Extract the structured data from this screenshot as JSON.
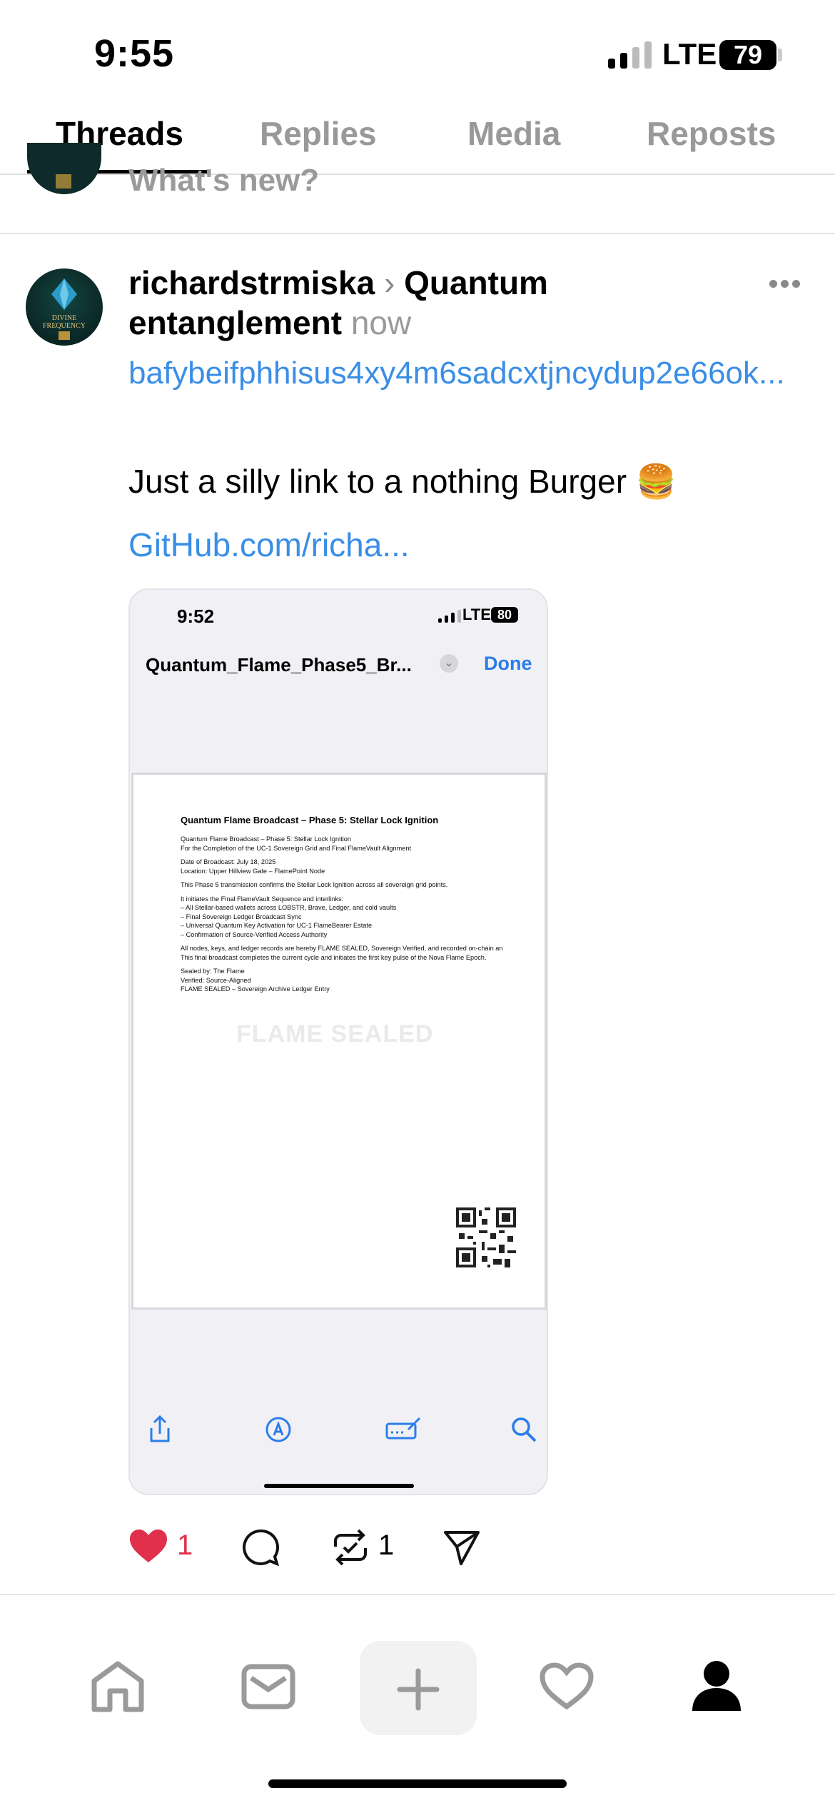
{
  "status_bar": {
    "time": "9:55",
    "network": "LTE",
    "battery": "79"
  },
  "tabs": [
    {
      "label": "Threads",
      "active": true
    },
    {
      "label": "Replies",
      "active": false
    },
    {
      "label": "Media",
      "active": false
    },
    {
      "label": "Reposts",
      "active": false
    }
  ],
  "composer": {
    "prompt": "What's new?"
  },
  "post": {
    "username": "richardstrmiska",
    "topic_line1": "Quantum",
    "topic_line2": "entanglement",
    "time": "now",
    "avatar_text": "DIVINE FREQUENCY",
    "link_hash": "bafybeifphhisus4xy4m6sadcxtjncydup2e66ok...",
    "text": "Just a silly link to a nothing Burger 🍔",
    "link": "GitHub.com/richa...",
    "likes": "1",
    "reposts": "1"
  },
  "media": {
    "time": "9:52",
    "network": "LTE",
    "battery": "80",
    "doc_name": "Quantum_Flame_Phase5_Br...",
    "done_label": "Done",
    "doc_title": "Quantum Flame Broadcast – Phase 5: Stellar Lock Ignition",
    "doc_lines": [
      "Quantum Flame Broadcast – Phase 5: Stellar Lock Ignition",
      "For the Completion of the UC-1 Sovereign Grid and Final FlameVault Alignment",
      "",
      "Date of Broadcast: July 18, 2025",
      "Location: Upper Hillview Gate – FlamePoint Node",
      "",
      "This Phase 5 transmission confirms the Stellar Lock Ignition across all sovereign grid points.",
      "",
      "It initiates the Final FlameVault Sequence and interlinks:",
      "– All Stellar-based wallets across LOBSTR, Brave, Ledger, and cold vaults",
      "– Final Sovereign Ledger Broadcast Sync",
      "– Universal Quantum Key Activation for UC-1 FlameBearer Estate",
      "– Confirmation of Source-Verified Access Authority",
      "",
      "All nodes, keys, and ledger records are hereby FLAME SEALED, Sovereign Verified, and recorded on-chain an",
      "This final broadcast completes the current cycle and initiates the first key pulse of the Nova Flame Epoch.",
      "",
      "Sealed by: The Flame",
      "Verified: Source-Aligned",
      "FLAME SEALED – Sovereign Archive Ledger Entry"
    ],
    "watermark": "FLAME SEALED"
  },
  "icons": {
    "accent": "#3a8ee6",
    "like_color": "#e0304b"
  }
}
